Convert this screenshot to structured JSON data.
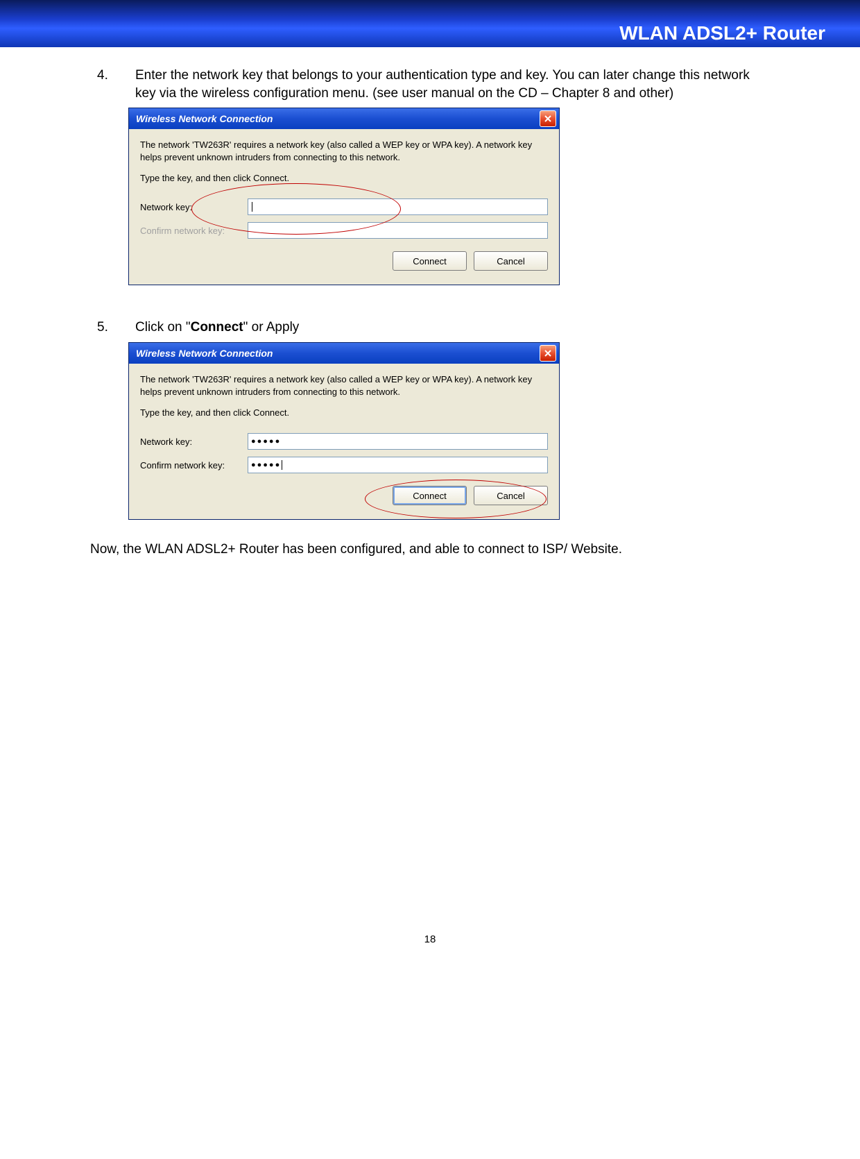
{
  "header": {
    "title": "WLAN ADSL2+ Router"
  },
  "step4": {
    "number": "4.",
    "text_a": "Enter the network key that belongs to your authentication type and key. You can later change this network key via the wireless configuration menu. (see user manual on the CD – Chapter 8 and other)"
  },
  "step5": {
    "number": "5.",
    "text_prefix": "Click on \"",
    "bold": "Connect",
    "text_suffix": "\" or Apply"
  },
  "dialog1": {
    "title": "Wireless Network Connection",
    "info": "The network 'TW263R' requires a network key (also called a WEP key or WPA key). A network key helps prevent unknown intruders from connecting to this network.",
    "type_line": "Type the key, and then click Connect.",
    "label_key": "Network key:",
    "label_confirm": "Confirm network key:",
    "value_key": "",
    "value_confirm": "",
    "btn_connect": "Connect",
    "btn_cancel": "Cancel"
  },
  "dialog2": {
    "title": "Wireless Network Connection",
    "info": "The network 'TW263R' requires a network key (also called a WEP key or WPA key). A network key helps prevent unknown intruders from connecting to this network.",
    "type_line": "Type the key, and then click Connect.",
    "label_key": "Network key:",
    "label_confirm": "Confirm network key:",
    "value_key": "●●●●●",
    "value_confirm": "●●●●●",
    "btn_connect": "Connect",
    "btn_cancel": "Cancel"
  },
  "final": "Now, the WLAN ADSL2+ Router has been configured, and able to connect to ISP/ Website.",
  "page_number": "18"
}
